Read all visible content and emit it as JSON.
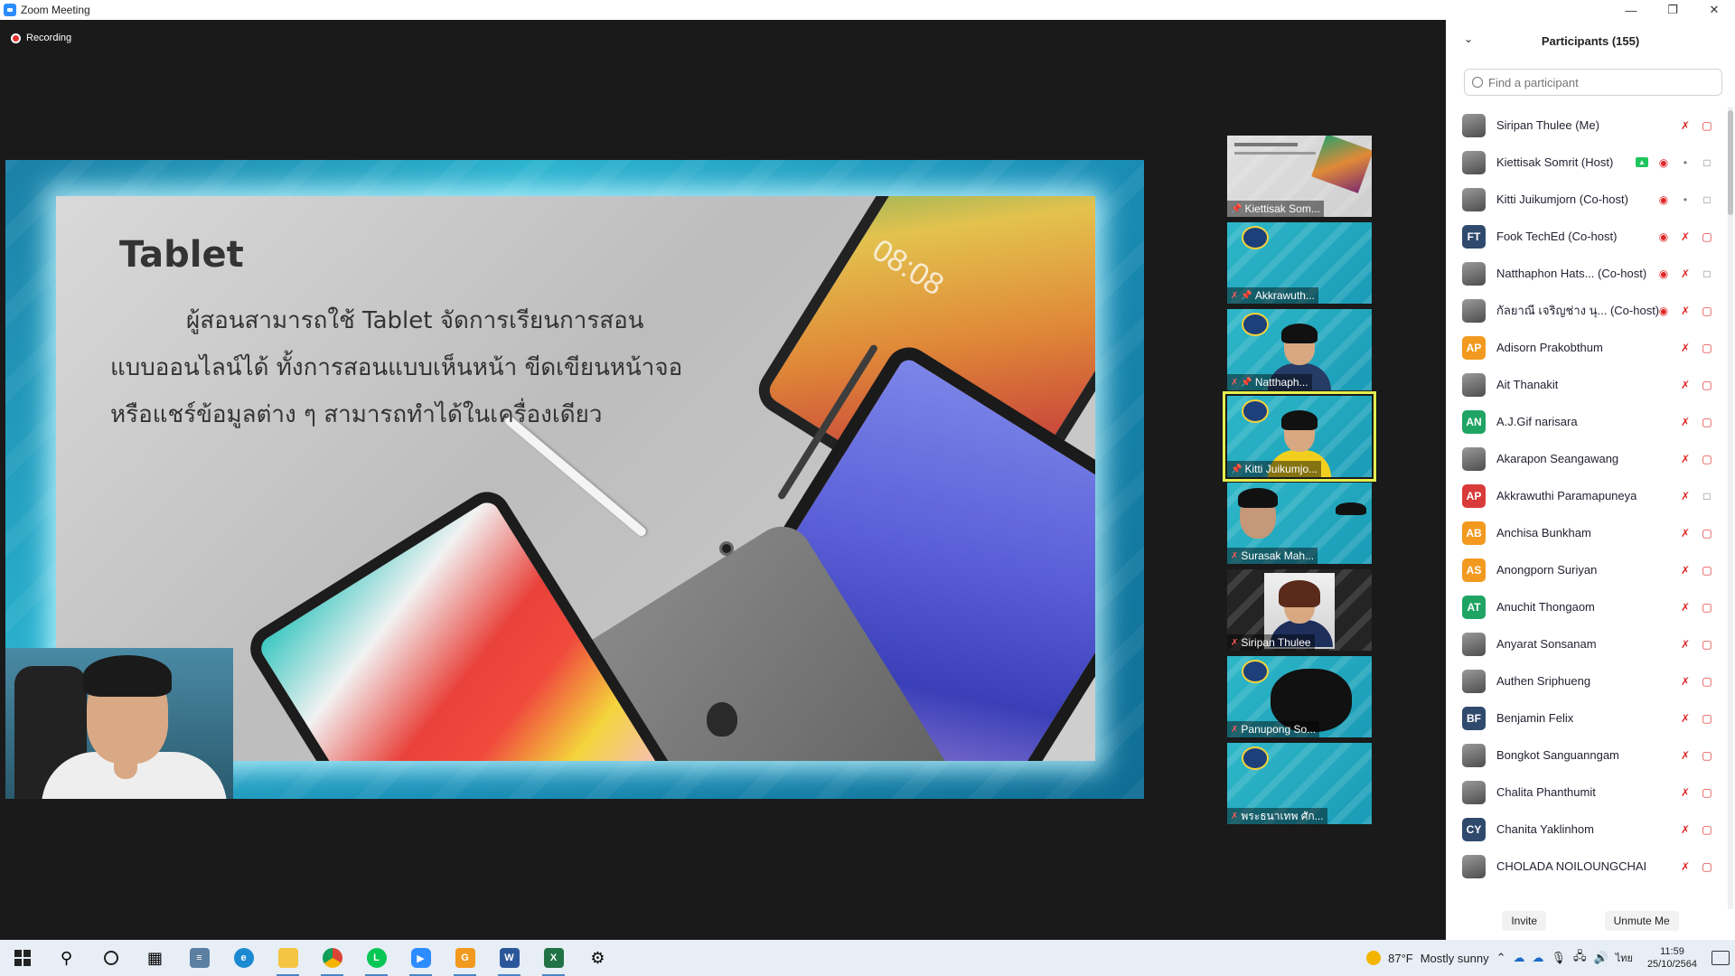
{
  "window": {
    "title": "Zoom Meeting"
  },
  "recording": {
    "label": "Recording"
  },
  "slide": {
    "title": "Tablet",
    "lines": [
      "ผู้สอนสามารถใช้ Tablet จัดการเรียนการสอน",
      "แบบออนไลน์ได้ ทั้งการสอนแบบเห็นหน้า ขีดเขียนหน้าจอ",
      "หรือแชร์ข้อมูลต่าง ๆ สามารถทำได้ในเครื่องเดียว"
    ],
    "tablet_clock": "08:08"
  },
  "gallery": {
    "tiles": [
      {
        "name": "Kiettisak Som..."
      },
      {
        "name": "Akkrawuth..."
      },
      {
        "name": "Natthaph..."
      },
      {
        "name": "Kitti Juikumjo..."
      },
      {
        "name": "Surasak Mah..."
      },
      {
        "name": "Siripan Thulee"
      },
      {
        "name": "Panupong So..."
      },
      {
        "name": "พระธนาเทพ ศัก..."
      }
    ]
  },
  "participants": {
    "title": "Participants (155)",
    "search_placeholder": "Find a participant",
    "list": [
      {
        "name": "Siripan Thulee (Me)",
        "initials": "",
        "color": ""
      },
      {
        "name": "Kiettisak Somrit (Host)",
        "initials": "",
        "color": ""
      },
      {
        "name": "Kitti Juikumjorn (Co-host)",
        "initials": "",
        "color": ""
      },
      {
        "name": "Fook TechEd (Co-host)",
        "initials": "FT",
        "color": "#2f4a6d"
      },
      {
        "name": "Natthaphon Hats...  (Co-host)",
        "initials": "",
        "color": ""
      },
      {
        "name": "กัลยาณี เจริญช่าง นุ...  (Co-host)",
        "initials": "",
        "color": ""
      },
      {
        "name": "Adisorn Prakobthum",
        "initials": "AP",
        "color": "#f29a1f"
      },
      {
        "name": "Ait Thanakit",
        "initials": "",
        "color": ""
      },
      {
        "name": "A.J.Gif narisara",
        "initials": "AN",
        "color": "#1fa463"
      },
      {
        "name": "Akarapon Seangawang",
        "initials": "",
        "color": ""
      },
      {
        "name": "Akkrawuthi Paramapuneya",
        "initials": "AP",
        "color": "#d93b3b"
      },
      {
        "name": "Anchisa Bunkham",
        "initials": "AB",
        "color": "#f29a1f"
      },
      {
        "name": "Anongporn Suriyan",
        "initials": "AS",
        "color": "#f29a1f"
      },
      {
        "name": "Anuchit Thongaom",
        "initials": "AT",
        "color": "#1fa463"
      },
      {
        "name": "Anyarat Sonsanam",
        "initials": "",
        "color": ""
      },
      {
        "name": "Authen Sriphueng",
        "initials": "",
        "color": ""
      },
      {
        "name": "Benjamin Felix",
        "initials": "BF",
        "color": "#2f4a6d"
      },
      {
        "name": "Bongkot Sanguanngam",
        "initials": "",
        "color": ""
      },
      {
        "name": "Chalita Phanthumit",
        "initials": "",
        "color": ""
      },
      {
        "name": "Chanita Yaklinhom",
        "initials": "CY",
        "color": "#2f4a6d"
      },
      {
        "name": "CHOLADA NOILOUNGCHAI",
        "initials": "",
        "color": ""
      }
    ],
    "footer": {
      "invite": "Invite",
      "unmute": "Unmute Me"
    }
  },
  "taskbar": {
    "weather": {
      "temp": "87°F",
      "condition": "Mostly sunny"
    },
    "language": "ไทย",
    "time": "11:59",
    "date": "25/10/2564"
  }
}
